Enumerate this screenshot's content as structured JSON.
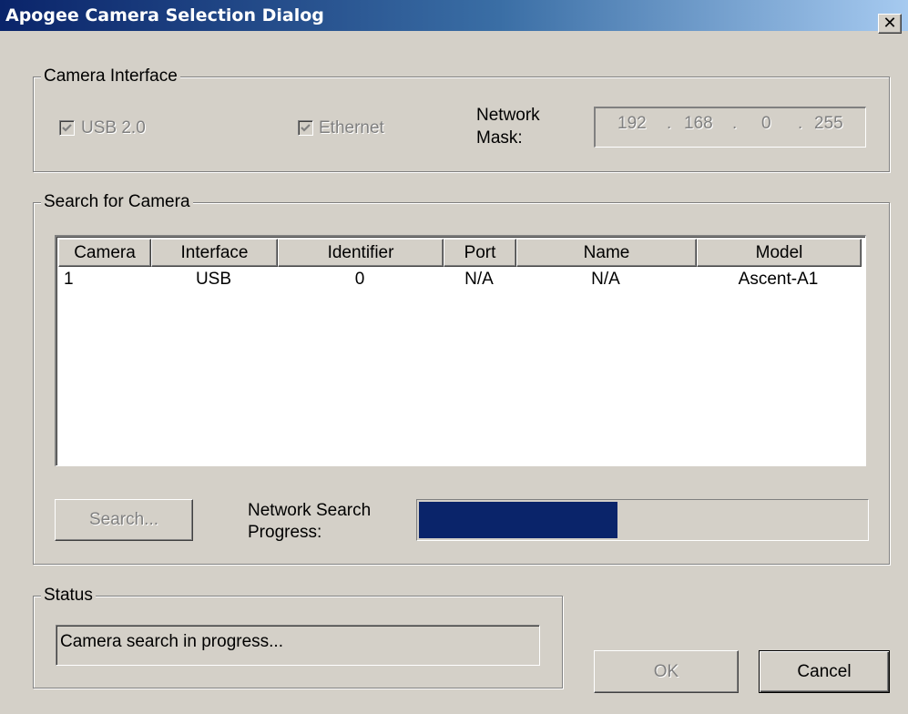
{
  "window": {
    "title": "Apogee Camera Selection Dialog",
    "close_glyph": "✕",
    "close_icon": "close-icon"
  },
  "camera_interface": {
    "group_label": "Camera Interface",
    "usb_label": "USB 2.0",
    "usb_checked": true,
    "ethernet_label": "Ethernet",
    "ethernet_checked": true,
    "mask_label_line1": "Network",
    "mask_label_line2": "Mask:",
    "mask_octets": [
      "192",
      "168",
      "0",
      "255"
    ],
    "mask_separator": "."
  },
  "search": {
    "group_label": "Search for Camera",
    "columns": [
      "Camera",
      "Interface",
      "Identifier",
      "Port",
      "Name",
      "Model"
    ],
    "rows": [
      [
        "1",
        "USB",
        "0",
        "N/A",
        "N/A",
        "Ascent-A1"
      ]
    ],
    "search_button": "Search...",
    "progress_label_line1": "Network Search",
    "progress_label_line2": "Progress:",
    "progress_fraction": 0.445,
    "progress_color": "#0a246a"
  },
  "status": {
    "group_label": "Status",
    "message": "Camera search in progress..."
  },
  "buttons": {
    "ok": "OK",
    "cancel": "Cancel"
  }
}
